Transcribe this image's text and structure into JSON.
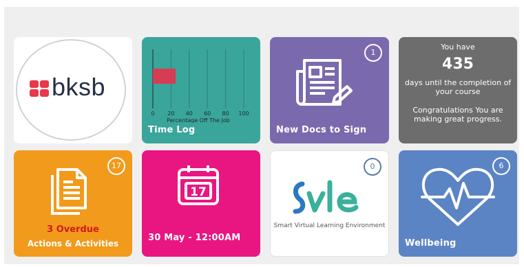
{
  "logo": {
    "brand_text": "bksb"
  },
  "time_log": {
    "title": "Time Log",
    "chart_data": {
      "type": "bar",
      "orientation": "horizontal",
      "categories": [
        ""
      ],
      "values": [
        25
      ],
      "xlabel": "Percentage Off The Job",
      "xlim": [
        0,
        100
      ],
      "xticks": [
        0,
        20,
        40,
        60,
        80,
        100
      ],
      "bar_color": "#d63c52",
      "grid": true
    }
  },
  "new_docs": {
    "title": "New Docs to Sign",
    "badge": "1"
  },
  "days": {
    "line1": "You have",
    "count": "435",
    "line2": "days until the completion of your course",
    "line3": "Congratulations You are making great progress."
  },
  "actions": {
    "badge": "17",
    "overdue": "3 Overdue",
    "title": "Actions & Activities"
  },
  "date_tile": {
    "calendar_day": "17",
    "title": "30 May - 12:00AM"
  },
  "vle": {
    "badge": "0",
    "caption": "Smart Virtual Learning Environment",
    "logo_text": "Svle"
  },
  "wellbeing": {
    "title": "Wellbeing",
    "badge": "6"
  },
  "colors": {
    "teal": "#3aa59b",
    "purple": "#7a6aad",
    "grey": "#6d6d6d",
    "orange": "#f29a1c",
    "pink": "#e91581",
    "blue": "#5b84c4",
    "vle_blue": "#2b79c2",
    "vle_green": "#3bb09a"
  }
}
